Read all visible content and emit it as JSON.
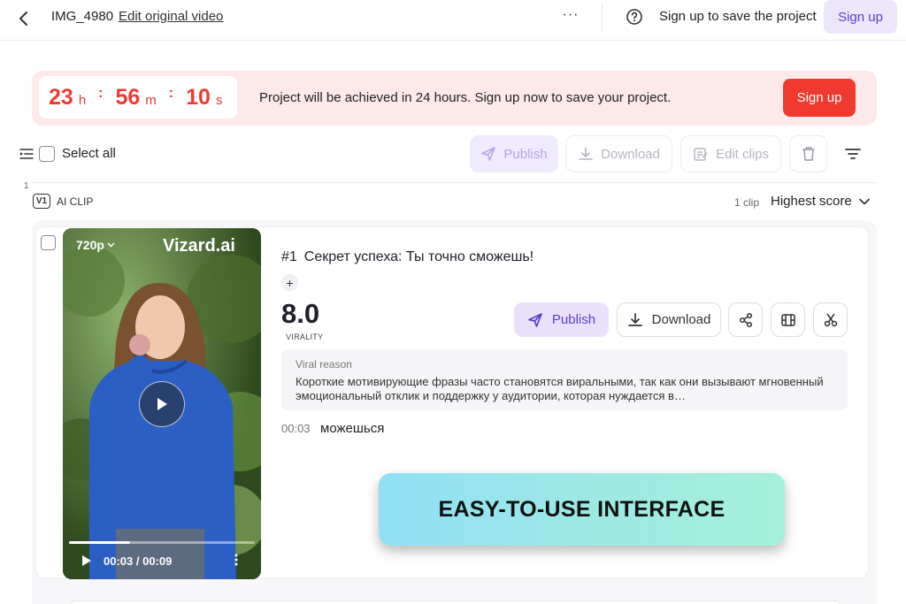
{
  "header": {
    "project_name": "IMG_4980",
    "edit_link": "Edit original video",
    "more_label": "···",
    "save_prompt": "Sign up to save the project",
    "signup_label": "Sign up"
  },
  "banner": {
    "hours": "23",
    "hours_unit": "h",
    "minutes": "56",
    "minutes_unit": "m",
    "seconds": "10",
    "seconds_unit": "s",
    "separator": ":",
    "message": "Project will be achieved in 24 hours. Sign up now to save your project.",
    "signup_label": "Sign up"
  },
  "toolbar": {
    "select_all": "Select all",
    "publish": "Publish",
    "download": "Download",
    "edit_clips": "Edit clips"
  },
  "section": {
    "index": "1",
    "version_badge": "V1",
    "label": "AI CLIP",
    "count": "1 clip",
    "sort": "Highest score"
  },
  "clip": {
    "resolution": "720p",
    "watermark": "Vizard.ai",
    "time": "00:03 / 00:09",
    "progress": 0.33,
    "number": "#1",
    "title": "Секрет успеха: Ты точно сможешь!",
    "plus": "+",
    "score": "8.0",
    "score_label": "VIRALITY",
    "publish": "Publish",
    "download": "Download",
    "reason_label": "Viral reason",
    "reason_text": "Короткие мотивирующие фразы часто становятся виральными, так как они вызывают мгновенный эмоциональный отклик и поддержку у аудитории, которая нуждается в…",
    "transcript_time": "00:03",
    "transcript_text": "можешься"
  },
  "promo": {
    "text": "EASY-TO-USE INTERFACE"
  },
  "colors": {
    "accent": "#5b3fd1",
    "accent_soft": "#e9e1fb",
    "danger": "#f03a2f",
    "banner_bg": "#fde9e9"
  }
}
